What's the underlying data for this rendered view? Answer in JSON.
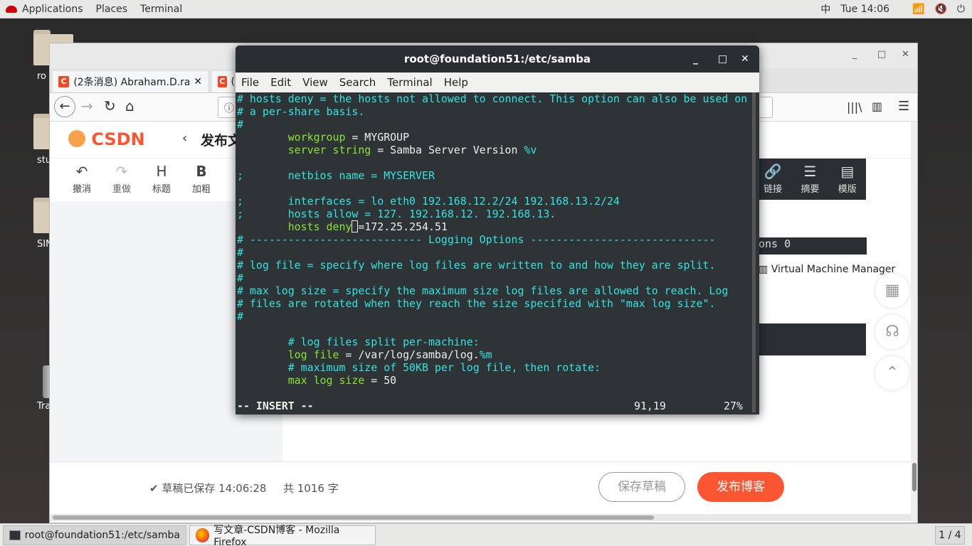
{
  "topbar": {
    "applications": "Applications",
    "places": "Places",
    "terminal": "Terminal",
    "input_method": "中",
    "clock": "Tue 14:06"
  },
  "desktop": {
    "icons": [
      {
        "label": "ro",
        "kind": "home-folder"
      },
      {
        "label": "stu",
        "kind": "folder"
      },
      {
        "label": "SIN",
        "kind": "folder"
      },
      {
        "label": "Tra",
        "kind": "trash"
      }
    ]
  },
  "firefox": {
    "tabs": [
      {
        "favicon": "C",
        "title": "(2条消息) Abraham.D.rac"
      },
      {
        "favicon": "C",
        "title": "("
      }
    ],
    "page": {
      "logo": "CSDN",
      "title": "发布文",
      "toolbar": [
        {
          "icon": "↶",
          "label": "撤消"
        },
        {
          "icon": "↷",
          "label": "重做"
        },
        {
          "icon": "H",
          "label": "标题"
        },
        {
          "icon": "B",
          "label": "加粗"
        }
      ],
      "right_toolbar": [
        {
          "icon": "🔗",
          "label": "链接"
        },
        {
          "icon": "☰",
          "label": "摘要"
        },
        {
          "icon": "▤",
          "label": "模版"
        }
      ],
      "background_text": "ons 0",
      "vmm": "Virtual Machine Manager",
      "saved": "草稿已保存 14:06:28",
      "word_count": "共 1016 字",
      "draft_button": "保存草稿",
      "publish_button": "发布博客"
    }
  },
  "terminal": {
    "title": "root@foundation51:/etc/samba",
    "menu": [
      "File",
      "Edit",
      "View",
      "Search",
      "Terminal",
      "Help"
    ],
    "lines": [
      {
        "cls": "cm",
        "text": "# hosts deny = the hosts not allowed to connect. This option can also be used on"
      },
      {
        "cls": "cm",
        "text": "# a per-share basis."
      },
      {
        "cls": "cm",
        "text": "#"
      },
      {
        "cls": "mix",
        "key": "        workgroup",
        "val": " = MYGROUP"
      },
      {
        "cls": "mix",
        "key": "        server string",
        "val": " = Samba Server Version %v"
      },
      {
        "cls": "tx",
        "text": ""
      },
      {
        "cls": "cm",
        "text": ";       netbios name = MYSERVER"
      },
      {
        "cls": "tx",
        "text": ""
      },
      {
        "cls": "cm",
        "text": ";       interfaces = lo eth0 192.168.12.2/24 192.168.13.2/24"
      },
      {
        "cls": "cm",
        "text": ";       hosts allow = 127. 192.168.12. 192.168.13."
      },
      {
        "cls": "cursorline",
        "key": "        hosts deny",
        "val": "=172.25.254.51"
      },
      {
        "cls": "cm",
        "text": "# --------------------------- Logging Options -----------------------------"
      },
      {
        "cls": "cm",
        "text": "#"
      },
      {
        "cls": "cm",
        "text": "# log file = specify where log files are written to and how they are split."
      },
      {
        "cls": "cm",
        "text": "#"
      },
      {
        "cls": "cm",
        "text": "# max log size = specify the maximum size log files are allowed to reach. Log"
      },
      {
        "cls": "cm",
        "text": "# files are rotated when they reach the size specified with \"max log size\"."
      },
      {
        "cls": "cm",
        "text": "#"
      },
      {
        "cls": "tx",
        "text": ""
      },
      {
        "cls": "cm",
        "text": "        # log files split per-machine:"
      },
      {
        "cls": "mix",
        "key": "        log file",
        "val": " = /var/log/samba/log.%m"
      },
      {
        "cls": "cm",
        "text": "        # maximum size of 50KB per log file, then rotate:"
      },
      {
        "cls": "mix",
        "key": "        max log size",
        "val": " = 50"
      }
    ],
    "status_mode": "-- INSERT --",
    "status_pos": "91,19",
    "status_pct": "27%"
  },
  "taskbar": {
    "tasks": [
      {
        "label": "root@foundation51:/etc/samba",
        "icon": "terminal-icon"
      },
      {
        "label": "写文章-CSDN博客 - Mozilla Firefox",
        "icon": "firefox-icon"
      }
    ],
    "pager": "1 / 4"
  },
  "colors": {
    "terminal_bg": "#2e3436",
    "comment": "#34e2e2",
    "keyword": "#8ae234",
    "csdn_red": "#fc5531"
  }
}
